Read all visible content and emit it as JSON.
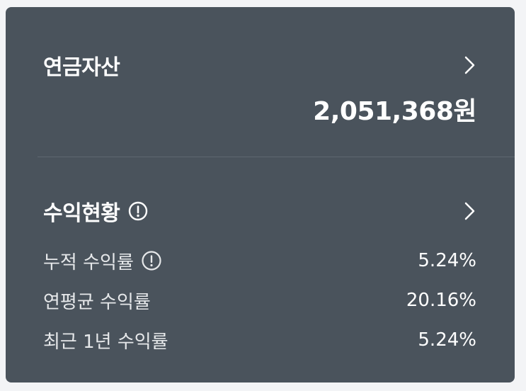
{
  "pension": {
    "title": "연금자산",
    "amount": "2,051,368원"
  },
  "profit": {
    "title": "수익현황",
    "rows": [
      {
        "label": "누적 수익률",
        "value": "5.24%"
      },
      {
        "label": "연평균 수익률",
        "value": "20.16%"
      },
      {
        "label": "최근 1년 수익률",
        "value": "5.24%"
      }
    ]
  },
  "colors": {
    "card_bg": "#4a535c",
    "page_bg": "#f3f4f6",
    "text": "#ffffff"
  },
  "icons": [
    "chevron-right-icon",
    "info-icon"
  ]
}
